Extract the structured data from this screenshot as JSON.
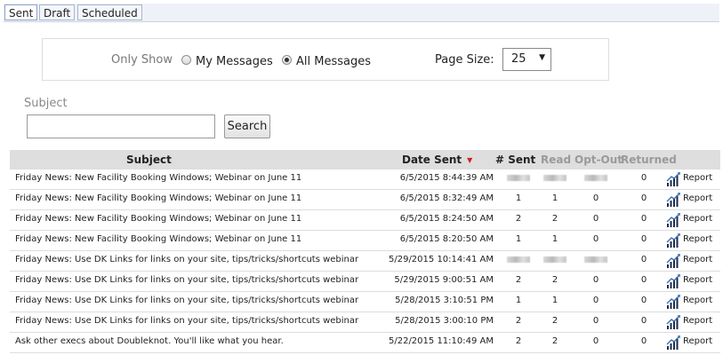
{
  "tabs": [
    {
      "label": "Sent",
      "active": true
    },
    {
      "label": "Draft",
      "active": false
    },
    {
      "label": "Scheduled",
      "active": false
    }
  ],
  "filter": {
    "only_show_label": "Only Show",
    "option_my": "My Messages",
    "option_all": "All Messages",
    "selected": "all",
    "page_size_label": "Page Size:",
    "page_size_value": "25"
  },
  "search": {
    "label": "Subject",
    "value": "",
    "placeholder": "",
    "button_label": "Search"
  },
  "table": {
    "columns": {
      "subject": "Subject",
      "date_sent": "Date Sent",
      "sent": "# Sent",
      "read": "Read",
      "optout": "Opt-Out",
      "returned": "Returned"
    },
    "report_label": "Report",
    "rows": [
      {
        "subject": "Friday News: New Facility Booking Windows; Webinar on June 11",
        "date": "6/5/2015 8:44:39 AM",
        "sent": null,
        "read": null,
        "optout": null,
        "returned": "0"
      },
      {
        "subject": "Friday News: New Facility Booking Windows; Webinar on June 11",
        "date": "6/5/2015 8:32:49 AM",
        "sent": "1",
        "read": "1",
        "optout": "0",
        "returned": "0"
      },
      {
        "subject": "Friday News: New Facility Booking Windows; Webinar on June 11",
        "date": "6/5/2015 8:24:50 AM",
        "sent": "2",
        "read": "2",
        "optout": "0",
        "returned": "0"
      },
      {
        "subject": "Friday News: New Facility Booking Windows; Webinar on June 11",
        "date": "6/5/2015 8:20:50 AM",
        "sent": "1",
        "read": "1",
        "optout": "0",
        "returned": "0"
      },
      {
        "subject": "Friday News: Use DK Links for links on your site, tips/tricks/shortcuts webinar",
        "date": "5/29/2015 10:14:41 AM",
        "sent": null,
        "read": null,
        "optout": null,
        "returned": "0"
      },
      {
        "subject": "Friday News: Use DK Links for links on your site, tips/tricks/shortcuts webinar",
        "date": "5/29/2015 9:00:51 AM",
        "sent": "2",
        "read": "2",
        "optout": "0",
        "returned": "0"
      },
      {
        "subject": "Friday News: Use DK Links for links on your site, tips/tricks/shortcuts webinar",
        "date": "5/28/2015 3:10:51 PM",
        "sent": "1",
        "read": "1",
        "optout": "0",
        "returned": "0"
      },
      {
        "subject": "Friday News: Use DK Links for links on your site, tips/tricks/shortcuts webinar",
        "date": "5/28/2015 3:00:10 PM",
        "sent": "2",
        "read": "2",
        "optout": "0",
        "returned": "0"
      },
      {
        "subject": "Ask other execs about Doubleknot. You'll like what you hear.",
        "date": "5/22/2015 11:10:49 AM",
        "sent": "2",
        "read": "2",
        "optout": "0",
        "returned": "0"
      }
    ]
  },
  "colors": {
    "header_bg": "#dedede",
    "tab_bar_bg": "#eef2f8",
    "sort_arrow": "#cc2222",
    "report_icon": "#1a2a4a"
  },
  "icons": {
    "report": "report-chart-icon",
    "sort": "sort-descending-icon"
  }
}
